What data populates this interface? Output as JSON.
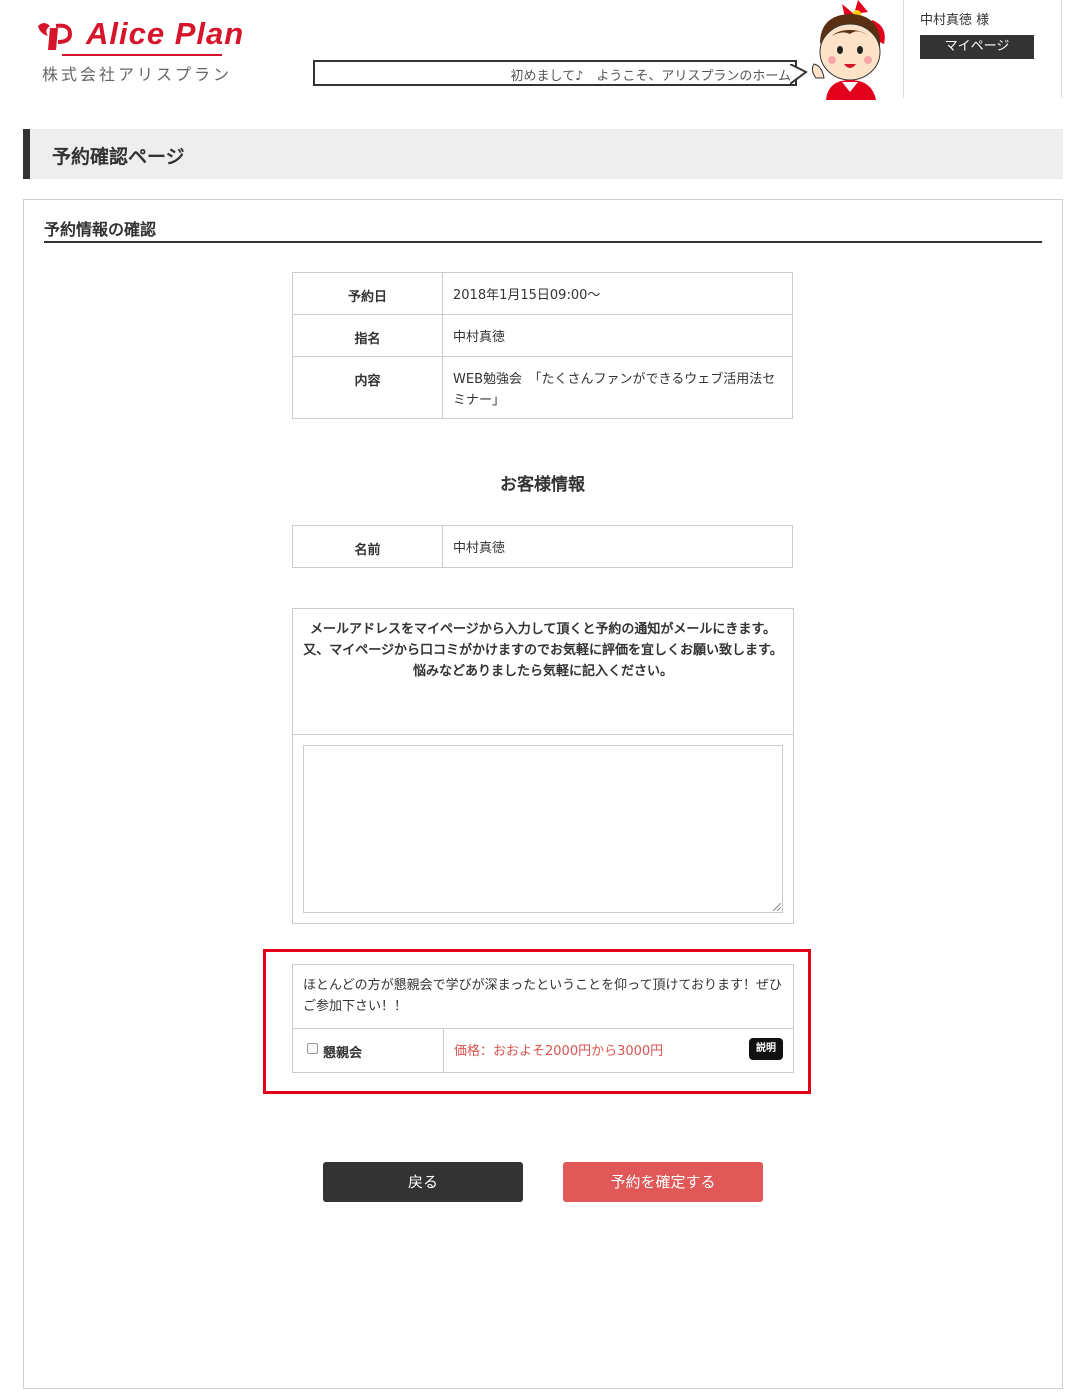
{
  "header": {
    "logo_title": "Alice Plan",
    "logo_subtitle": "株式会社アリスプラン",
    "marquee_text": "初めまして♪　ようこそ、アリスプランのホーム",
    "user_name": "中村真徳 様",
    "mypage_label": "マイページ"
  },
  "page": {
    "title": "予約確認ページ",
    "section_heading": "予約情報の確認"
  },
  "reservation": {
    "date_label": "予約日",
    "date_value": "2018年1月15日09:00〜",
    "nominee_label": "指名",
    "nominee_value": "中村真徳",
    "content_label": "内容",
    "content_value": "WEB勉強会　「たくさんファンができるウェブ活用法セミナー」"
  },
  "customer": {
    "title": "お客様情報",
    "name_label": "名前",
    "name_value": "中村真徳"
  },
  "memo": {
    "line1": "メールアドレスをマイページから入力して頂くと予約の通知がメールにきます。",
    "line2": "又、マイページから口コミがかけますのでお気軽に評価を宜しくお願い致します。",
    "line3": "悩みなどありましたら気軽に記入ください。",
    "value": ""
  },
  "party": {
    "description": "ほとんどの方が懇親会で学びが深まったということを仰って頂けております！ぜひご参加下さい！！",
    "label": "懇親会",
    "checked": false,
    "price": "価格：おおよそ2000円から3000円",
    "explain_label": "説明"
  },
  "buttons": {
    "back": "戻る",
    "confirm": "予約を確定する"
  },
  "colors": {
    "brand_red": "#d6152c",
    "dark": "#333333",
    "confirm": "#e05858",
    "price": "#d9534f",
    "highlight": "#e3001a"
  }
}
